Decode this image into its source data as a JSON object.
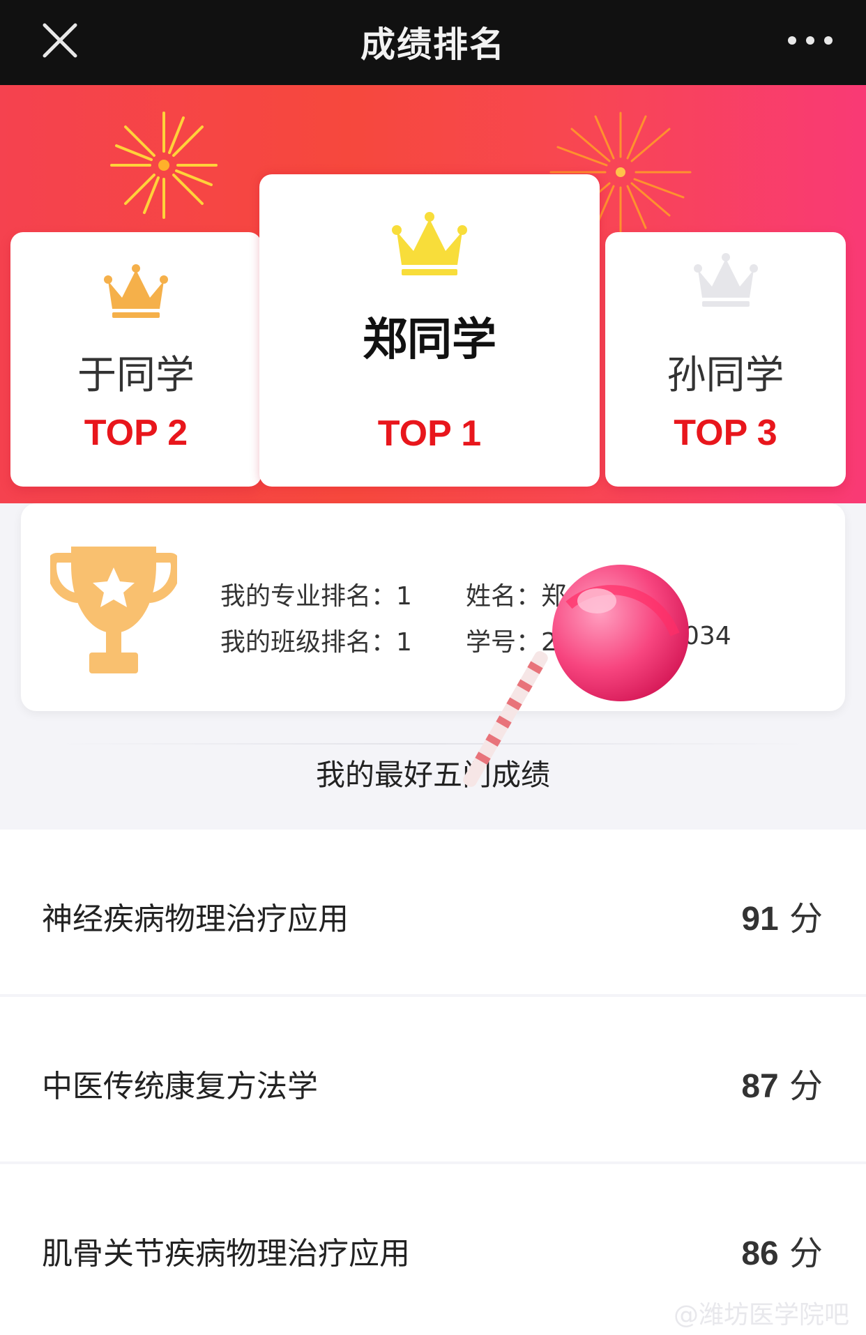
{
  "header": {
    "title": "成绩排名",
    "close_icon": "close-icon",
    "more_icon": "more-icon"
  },
  "podium": [
    {
      "name": "于同学",
      "rank": "TOP 2",
      "crown_color": "#f5b04a"
    },
    {
      "name": "郑同学",
      "rank": "TOP 1",
      "crown_color": "#f8dd3a"
    },
    {
      "name": "孙同学",
      "rank": "TOP 3",
      "crown_color": "#e6e6ea"
    }
  ],
  "my_info": {
    "major_rank": "我的专业排名：1",
    "class_rank": "我的班级排名：1",
    "name_label": "姓名：",
    "name_value": "郑",
    "id_label": "学号：",
    "id_value_start": "2",
    "id_value_end": "034"
  },
  "section_title": "我的最好五门成绩",
  "scores": [
    {
      "course": "神经疾病物理治疗应用",
      "score": "91",
      "unit": "分"
    },
    {
      "course": "中医传统康复方法学",
      "score": "87",
      "unit": "分"
    },
    {
      "course": "肌骨关节疾病物理治疗应用",
      "score": "86",
      "unit": "分"
    }
  ],
  "watermark": "@潍坊医学院吧",
  "colors": {
    "accent_red": "#e8161c",
    "hero_red": "#f6483d",
    "hero_pink": "#f93a75",
    "trophy": "#f9c06f"
  }
}
